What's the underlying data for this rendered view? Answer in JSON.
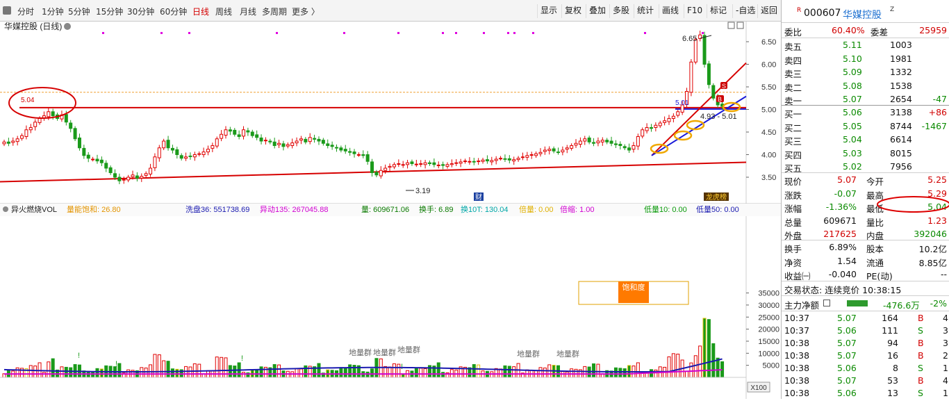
{
  "toolbar": {
    "timeframes": [
      "分时",
      "1分钟",
      "5分钟",
      "15分钟",
      "30分钟",
      "60分钟",
      "日线",
      "周线",
      "月线",
      "多周期",
      "更多 〉"
    ],
    "active_timeframe": "日线",
    "buttons": [
      "显示",
      "复权",
      "叠加",
      "多股",
      "统计",
      "画线",
      "F10",
      "标记",
      "-自选",
      "返回"
    ]
  },
  "main_chart": {
    "title": "华媒控股 (日线)",
    "price_axis": [
      "6.50",
      "6.00",
      "5.50",
      "5.00",
      "4.50",
      "4.00",
      "3.50"
    ],
    "annotations": {
      "high_label": "6.65",
      "low_label": "3.19",
      "resistance_label": "5.04",
      "level_label": "5.01",
      "range_label": "4.93 - 5.01",
      "marker_cai": "财",
      "marker_longhu": "龙虎榜",
      "buy_marker": "B",
      "sell_marker": "S"
    }
  },
  "volume_panel": {
    "title": "异火燃烧VOL",
    "indicators": [
      {
        "label": "量能饱和: 26.80",
        "color": "#e39400"
      },
      {
        "label": "洗盘36: 551738.69",
        "color": "#1a1ab0"
      },
      {
        "label": "异动135: 267045.88",
        "color": "#d100d1"
      },
      {
        "label": "量: 609671.06",
        "color": "#0a7a00"
      },
      {
        "label": "换手: 6.89",
        "color": "#0a7a00"
      },
      {
        "label": "换10T: 130.04",
        "color": "#00a7a7"
      },
      {
        "label": "倍量: 0.00",
        "color": "#e0b000"
      },
      {
        "label": "倍缩: 1.00",
        "color": "#d100d1"
      },
      {
        "label": "低量10: 0.00",
        "color": "#0a9a0a"
      },
      {
        "label": "低量50: 0.00",
        "color": "#1a1ab0"
      }
    ],
    "volume_axis": [
      "35000",
      "30000",
      "25000",
      "20000",
      "15000",
      "10000",
      "5000"
    ],
    "unit_label": "X100",
    "saturation_label": "饱和度",
    "cluster_labels": [
      "地量群",
      "地量群",
      "地量群",
      "地量群",
      "地量群"
    ]
  },
  "quote": {
    "code": "000607",
    "name": "华媒控股",
    "weibi_label": "委比",
    "weibi": "60.40%",
    "weicha_label": "委差",
    "weicha": "25959",
    "asks": [
      {
        "label": "卖五",
        "price": "5.11",
        "vol": "1003",
        "chg": ""
      },
      {
        "label": "卖四",
        "price": "5.10",
        "vol": "1981",
        "chg": ""
      },
      {
        "label": "卖三",
        "price": "5.09",
        "vol": "1332",
        "chg": ""
      },
      {
        "label": "卖二",
        "price": "5.08",
        "vol": "1538",
        "chg": ""
      },
      {
        "label": "卖一",
        "price": "5.07",
        "vol": "2654",
        "chg": "-47"
      }
    ],
    "bids": [
      {
        "label": "买一",
        "price": "5.06",
        "vol": "3138",
        "chg": "+86"
      },
      {
        "label": "买二",
        "price": "5.05",
        "vol": "8744",
        "chg": "-1467"
      },
      {
        "label": "买三",
        "price": "5.04",
        "vol": "6614",
        "chg": ""
      },
      {
        "label": "买四",
        "price": "5.03",
        "vol": "8015",
        "chg": ""
      },
      {
        "label": "买五",
        "price": "5.02",
        "vol": "7956",
        "chg": ""
      }
    ],
    "stats": [
      {
        "l1": "现价",
        "v1": "5.07",
        "c1": "red",
        "l2": "今开",
        "v2": "5.25",
        "c2": "red"
      },
      {
        "l1": "涨跌",
        "v1": "-0.07",
        "c1": "green",
        "l2": "最高",
        "v2": "5.29",
        "c2": "red"
      },
      {
        "l1": "涨幅",
        "v1": "-1.36%",
        "c1": "green",
        "l2": "最低",
        "v2": "5.04",
        "c2": "green"
      },
      {
        "l1": "总量",
        "v1": "609671",
        "c1": "dk",
        "l2": "量比",
        "v2": "1.23",
        "c2": "red"
      },
      {
        "l1": "外盘",
        "v1": "217625",
        "c1": "red",
        "l2": "内盘",
        "v2": "392046",
        "c2": "green"
      }
    ],
    "stats2": [
      {
        "l1": "换手",
        "v1": "6.89%",
        "l2": "股本",
        "v2": "10.2亿"
      },
      {
        "l1": "净资",
        "v1": "1.54",
        "l2": "流通",
        "v2": "8.85亿"
      },
      {
        "l1": "收益㈠",
        "v1": "-0.040",
        "l2": "PE(动)",
        "v2": "--"
      }
    ],
    "status": "交易状态: 连续竞价 10:38:15",
    "net_flow_label": "主力净额",
    "net_flow_value": "-476.6万",
    "net_flow_pct": "-2%",
    "trades": [
      {
        "t": "10:37",
        "p": "5.07",
        "v": "164",
        "d": "B",
        "n": "4"
      },
      {
        "t": "10:37",
        "p": "5.06",
        "v": "111",
        "d": "S",
        "n": "3"
      },
      {
        "t": "10:38",
        "p": "5.07",
        "v": "94",
        "d": "B",
        "n": "3"
      },
      {
        "t": "10:38",
        "p": "5.07",
        "v": "16",
        "d": "B",
        "n": "2"
      },
      {
        "t": "10:38",
        "p": "5.06",
        "v": "8",
        "d": "S",
        "n": "1"
      },
      {
        "t": "10:38",
        "p": "5.07",
        "v": "53",
        "d": "B",
        "n": "4"
      },
      {
        "t": "10:38",
        "p": "5.06",
        "v": "13",
        "d": "S",
        "n": "1"
      }
    ]
  }
}
